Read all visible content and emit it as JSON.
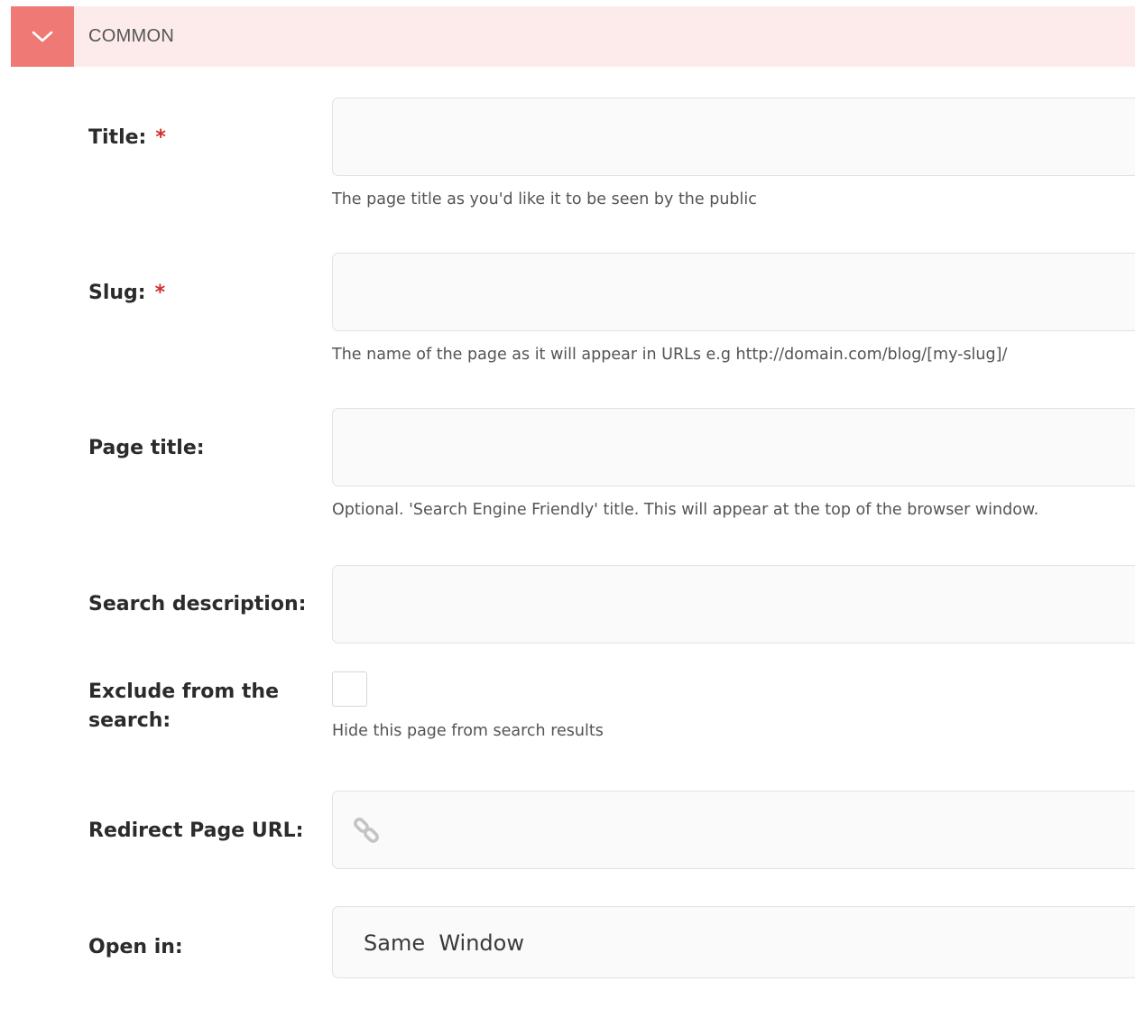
{
  "section": {
    "title": "COMMON",
    "toggle_icon": "chevron-down-icon",
    "accent_color": "#ef7a75",
    "header_bg": "#fdebeb"
  },
  "fields": {
    "title": {
      "label": "Title:",
      "required_marker": "*",
      "value": "",
      "help": "The page title as you'd like it to be seen by the public"
    },
    "slug": {
      "label": "Slug:",
      "required_marker": "*",
      "value": "",
      "help": "The name of the page as it will appear in URLs e.g http://domain.com/blog/[my-slug]/"
    },
    "page_title": {
      "label": "Page title:",
      "value": "",
      "help": "Optional. 'Search Engine Friendly' title. This will appear at the top of the browser window."
    },
    "search_description": {
      "label": "Search description:",
      "value": ""
    },
    "exclude_from_search": {
      "label_line1": "Exclude from the",
      "label_line2": "search:",
      "checked": false,
      "help": "Hide this page from search results"
    },
    "redirect_url": {
      "label": "Redirect Page URL:",
      "icon": "link-icon",
      "value": ""
    },
    "open_in": {
      "label": "Open in:",
      "selected": "Same  Window"
    }
  }
}
